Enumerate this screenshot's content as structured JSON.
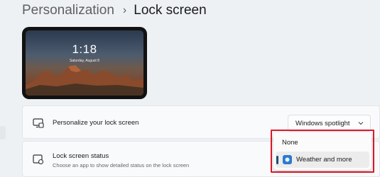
{
  "breadcrumb": {
    "parent": "Personalization",
    "separator": "›",
    "current": "Lock screen"
  },
  "preview": {
    "time": "1:18",
    "date": "Saturday, August 8"
  },
  "settings": [
    {
      "title": "Personalize your lock screen",
      "icon": "monitor-icon",
      "selected_value": "Windows spotlight"
    },
    {
      "title": "Lock screen status",
      "description": "Choose an app to show detailed status on the lock screen",
      "icon": "status-icon"
    }
  ],
  "dropdown": {
    "options": [
      {
        "label": "None",
        "selected": false
      },
      {
        "label": "Weather and more",
        "selected": true,
        "icon": "weather-icon"
      }
    ]
  },
  "colors": {
    "highlight": "#e0182a",
    "accent": "#1f4e79",
    "background": "#eef1f4",
    "card": "#f9fafb"
  }
}
